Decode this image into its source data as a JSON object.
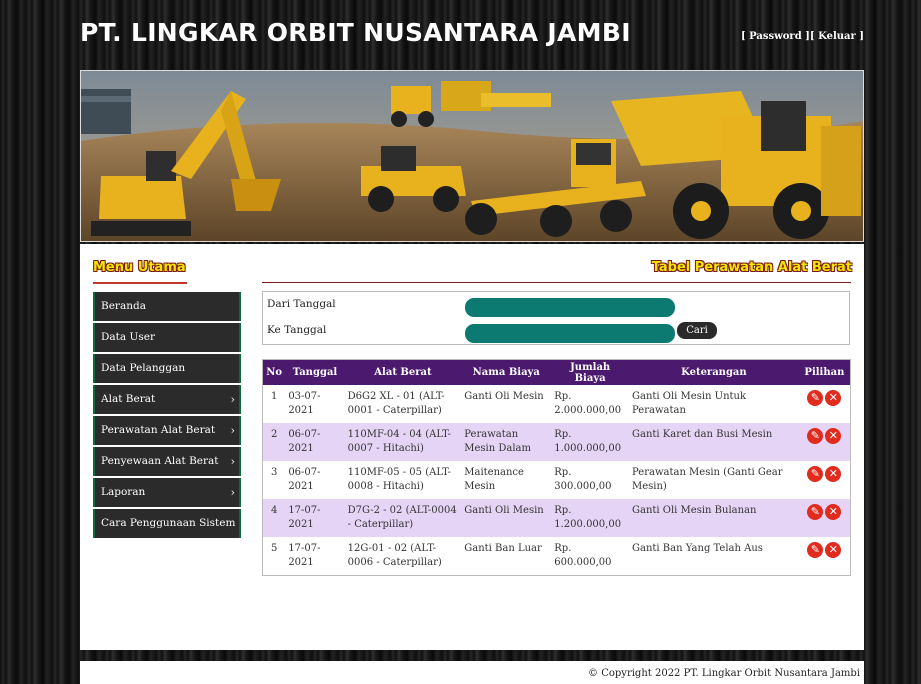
{
  "header": {
    "title": "PT. LINGKAR ORBIT NUSANTARA JAMBI",
    "links": [
      "[ Password ]",
      "[ Keluar ]"
    ]
  },
  "sidebar": {
    "heading": "Menu Utama",
    "items": [
      {
        "label": "Beranda",
        "has_submenu": false
      },
      {
        "label": "Data User",
        "has_submenu": false
      },
      {
        "label": "Data Pelanggan",
        "has_submenu": false
      },
      {
        "label": "Alat Berat",
        "has_submenu": true
      },
      {
        "label": "Perawatan Alat Berat",
        "has_submenu": true
      },
      {
        "label": "Penyewaan Alat Berat",
        "has_submenu": true
      },
      {
        "label": "Laporan",
        "has_submenu": true
      },
      {
        "label": "Cara Penggunaan Sistem",
        "has_submenu": false
      }
    ]
  },
  "main": {
    "heading": "Tabel Perawatan Alat Berat",
    "filter": {
      "from_label": "Dari Tanggal",
      "from_value": "",
      "to_label": "Ke Tanggal",
      "to_value": "",
      "search_button": "Cari"
    },
    "table": {
      "columns": [
        "No",
        "Tanggal",
        "Alat Berat",
        "Nama Biaya",
        "Jumlah Biaya",
        "Keterangan",
        "Pilihan"
      ],
      "rows": [
        {
          "no": "1",
          "tanggal": "03-07-2021",
          "alat": "D6G2 XL - 01 (ALT-0001 - Caterpillar)",
          "nama_biaya": "Ganti Oli Mesin",
          "jumlah": "Rp. 2.000.000,00",
          "keterangan": "Ganti Oli Mesin Untuk Perawatan"
        },
        {
          "no": "2",
          "tanggal": "06-07-2021",
          "alat": "110MF-04 - 04 (ALT-0007 - Hitachi)",
          "nama_biaya": "Perawatan Mesin Dalam",
          "jumlah": "Rp. 1.000.000,00",
          "keterangan": "Ganti Karet dan Busi Mesin"
        },
        {
          "no": "3",
          "tanggal": "06-07-2021",
          "alat": "110MF-05 - 05 (ALT-0008 - Hitachi)",
          "nama_biaya": "Maitenance Mesin",
          "jumlah": "Rp. 300.000,00",
          "keterangan": "Perawatan Mesin (Ganti Gear Mesin)"
        },
        {
          "no": "4",
          "tanggal": "17-07-2021",
          "alat": "D7G-2 - 02 (ALT-0004 - Caterpillar)",
          "nama_biaya": "Ganti Oli Mesin",
          "jumlah": "Rp. 1.200.000,00",
          "keterangan": "Ganti Oli Mesin Bulanan"
        },
        {
          "no": "5",
          "tanggal": "17-07-2021",
          "alat": "12G-01 - 02 (ALT-0006 - Caterpillar)",
          "nama_biaya": "Ganti Ban Luar",
          "jumlah": "Rp. 600.000,00",
          "keterangan": "Ganti Ban Yang Telah Aus"
        }
      ],
      "action_icons": [
        "edit-icon",
        "delete-icon"
      ]
    }
  },
  "footer": {
    "copyright": "© Copyright 2022 PT. Lingkar Orbit Nusantara Jambi"
  },
  "colors": {
    "accent_yellow": "#f2e600",
    "table_header": "#4b1a6e",
    "row_highlight": "#e6d4f6",
    "input_fill": "#0c7a70",
    "action_red": "#e02b1d"
  }
}
